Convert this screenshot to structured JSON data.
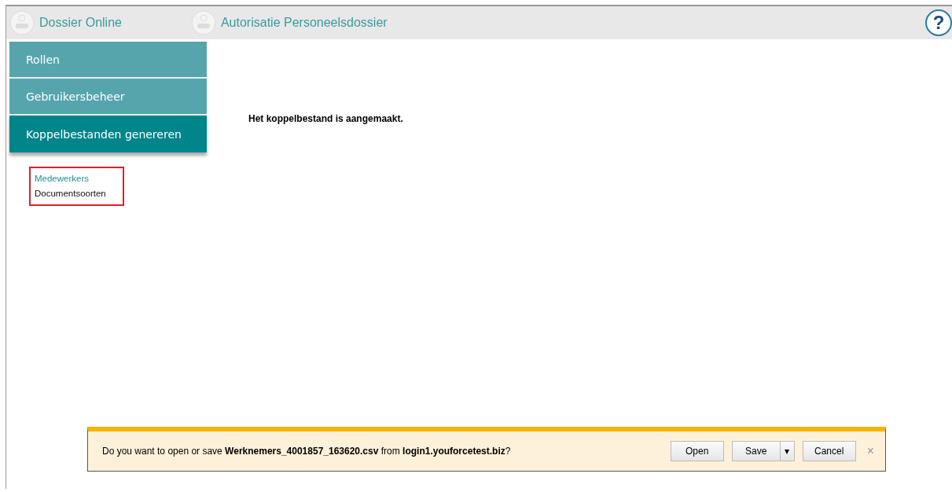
{
  "header": {
    "app_title": "Dossier Online",
    "page_title": "Autorisatie Personeelsdossier",
    "help": "?"
  },
  "sidebar": {
    "items": [
      {
        "label": "Rollen",
        "selected": false
      },
      {
        "label": "Gebruikersbeheer",
        "selected": false
      },
      {
        "label": "Koppelbestanden genereren",
        "selected": true
      }
    ],
    "subitems": [
      {
        "label": "Medewerkers",
        "selected": true
      },
      {
        "label": "Documentsoorten",
        "selected": false
      }
    ]
  },
  "message": "Het koppelbestand is aangemaakt.",
  "download_bar": {
    "text": "Do you want to open or save **Werknemers_4001857_163620.csv** from **login1.youforcetest.biz**?",
    "buttons": [
      "Open",
      "Save",
      "Cancel"
    ],
    "dropdown": "▾",
    "close": "×"
  }
}
